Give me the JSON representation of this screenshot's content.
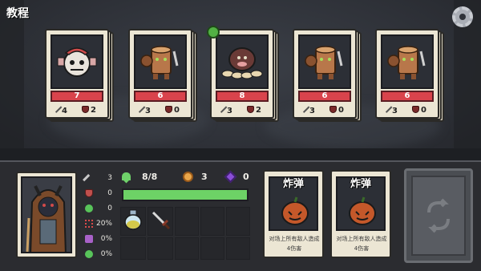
{
  "header": {
    "title": "教程"
  },
  "enemies": [
    {
      "name_icon": "clown-doll-monster",
      "hp": "7",
      "attack": "4",
      "armor": "2",
      "badge": false
    },
    {
      "name_icon": "stump-warrior-monster",
      "hp": "6",
      "attack": "3",
      "armor": "0",
      "badge": false
    },
    {
      "name_icon": "mushroom-boar-monster",
      "hp": "8",
      "attack": "3",
      "armor": "2",
      "badge": true
    },
    {
      "name_icon": "stump-warrior-monster",
      "hp": "6",
      "attack": "3",
      "armor": "0",
      "badge": false
    },
    {
      "name_icon": "stump-warrior-monster",
      "hp": "6",
      "attack": "3",
      "armor": "0",
      "badge": false
    }
  ],
  "player": {
    "portrait_icon": "horned-hooded-hero",
    "attributes": [
      {
        "icon": "sword-icon",
        "value": "3",
        "color": "#c9c9c9"
      },
      {
        "icon": "shield-icon",
        "value": "0",
        "color": "#c0504d"
      },
      {
        "icon": "clover-icon",
        "value": "0",
        "color": "#58c45a"
      },
      {
        "icon": "crit-icon",
        "value": "20%",
        "color": "#d84a4a"
      },
      {
        "icon": "dodge-icon",
        "value": "0%",
        "color": "#a861c8"
      },
      {
        "icon": "heal-plus-icon",
        "value": "0%",
        "color": "#58c45a"
      }
    ],
    "hp": "8/8",
    "hp_fraction": 1.0,
    "gold": "3",
    "gems": "0"
  },
  "inventory": [
    {
      "icon": "potion-bottle-icon"
    },
    {
      "icon": "dagger-icon"
    }
  ],
  "hand": [
    {
      "title": "炸弹",
      "desc_line1": "对场上所有敌人造成",
      "desc_line2": "4伤害"
    },
    {
      "title": "炸弹",
      "desc_line1": "对场上所有敌人造成",
      "desc_line2": "4伤害"
    }
  ],
  "colors": {
    "hp_bar": "#d9434c",
    "player_hp": "#6dd266",
    "panel": "#2b2c30"
  }
}
